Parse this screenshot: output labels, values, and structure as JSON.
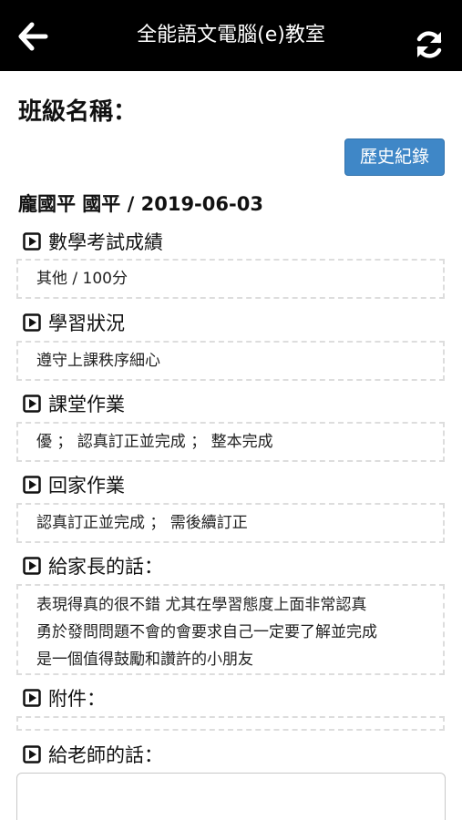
{
  "header": {
    "title": "全能語文電腦(e)教室",
    "back_icon": "arrow-left-icon",
    "refresh_icon": "refresh-icon"
  },
  "class_label": "班級名稱：",
  "history_button": "歷史紀錄",
  "student_info": "龐國平 國平 / 2019-06-03",
  "sections": {
    "math": {
      "heading": "數學考試成績",
      "value": "其他 / 100分"
    },
    "study": {
      "heading": "學習狀況",
      "value": "遵守上課秩序細心"
    },
    "classwork": {
      "heading": "課堂作業",
      "value": "優 ； 認真訂正並完成 ； 整本完成"
    },
    "homework": {
      "heading": "回家作業",
      "value": "認真訂正並完成 ； 需後續訂正"
    },
    "parent_message": {
      "heading": "給家長的話：",
      "lines": [
        "表現得真的很不錯 尤其在學習態度上面非常認真",
        "勇於發問問題不會的會要求自己一定要了解並完成",
        "是一個值得鼓勵和讚許的小朋友"
      ]
    },
    "attachment": {
      "heading": "附件：",
      "value": ""
    },
    "teacher_message": {
      "heading": "給老師的話：",
      "value": ""
    }
  },
  "colors": {
    "header_bg": "#000000",
    "button_bg": "#3f87c7",
    "dashed_border": "#dddddd"
  }
}
